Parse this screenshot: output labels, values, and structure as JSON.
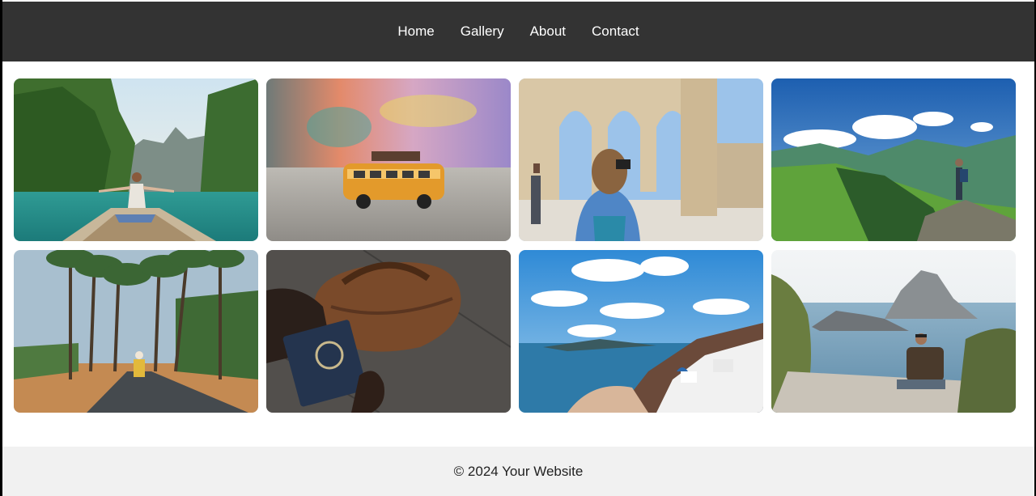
{
  "nav": {
    "items": [
      {
        "label": "Home"
      },
      {
        "label": "Gallery"
      },
      {
        "label": "About"
      },
      {
        "label": "Contact"
      }
    ]
  },
  "gallery": {
    "photos": [
      {
        "subject": "woman-on-longtail-boat-lagoon"
      },
      {
        "subject": "toy-camper-van"
      },
      {
        "subject": "traveler-photographing-arches"
      },
      {
        "subject": "hiker-on-mountain-ridge"
      },
      {
        "subject": "scooter-on-palm-road"
      },
      {
        "subject": "leather-bag-and-passport"
      },
      {
        "subject": "santorini-coastline"
      },
      {
        "subject": "man-sitting-by-sea-cliff"
      }
    ]
  },
  "footer": {
    "copyright": "© 2024 Your Website"
  },
  "colors": {
    "nav_bg": "#333333",
    "nav_text": "#ffffff",
    "footer_bg": "#f1f1f1",
    "page_bg": "#ffffff"
  }
}
